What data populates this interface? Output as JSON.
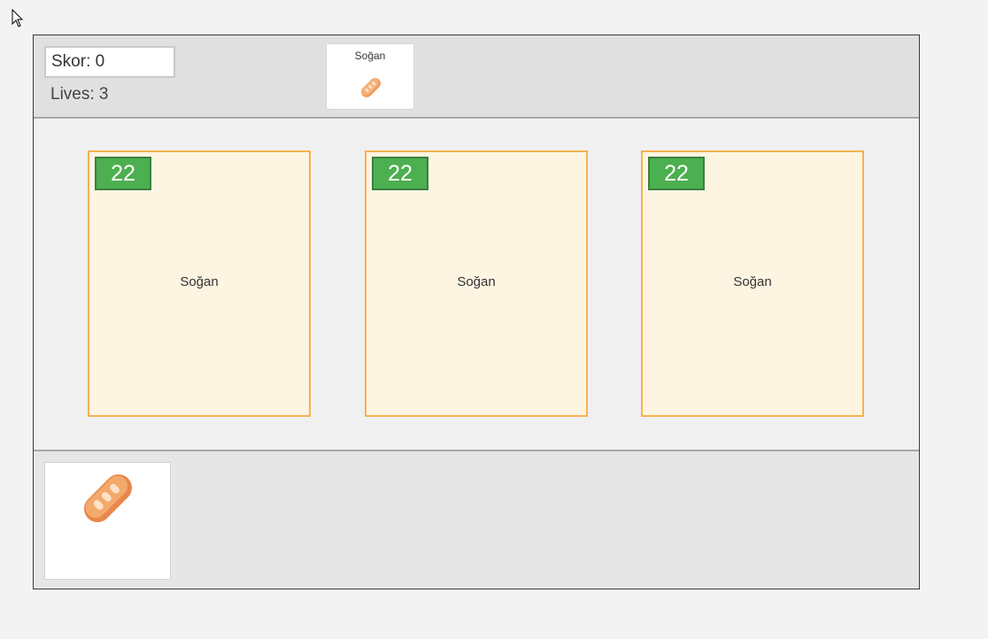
{
  "hud": {
    "score": "Skor: 0",
    "lives": "Lives: 3"
  },
  "target": {
    "label": "Soğan",
    "icon": "bread-icon"
  },
  "cards": [
    {
      "timer": "22",
      "label": "Soğan"
    },
    {
      "timer": "22",
      "label": "Soğan"
    },
    {
      "timer": "22",
      "label": "Soğan"
    }
  ],
  "inventory": {
    "items": [
      {
        "icon": "bread-icon"
      }
    ]
  },
  "colors": {
    "card_bg": "#fdf5e2",
    "card_border": "#f6b24e",
    "timer_bg": "#4caf50",
    "bread": "#f0a060"
  }
}
